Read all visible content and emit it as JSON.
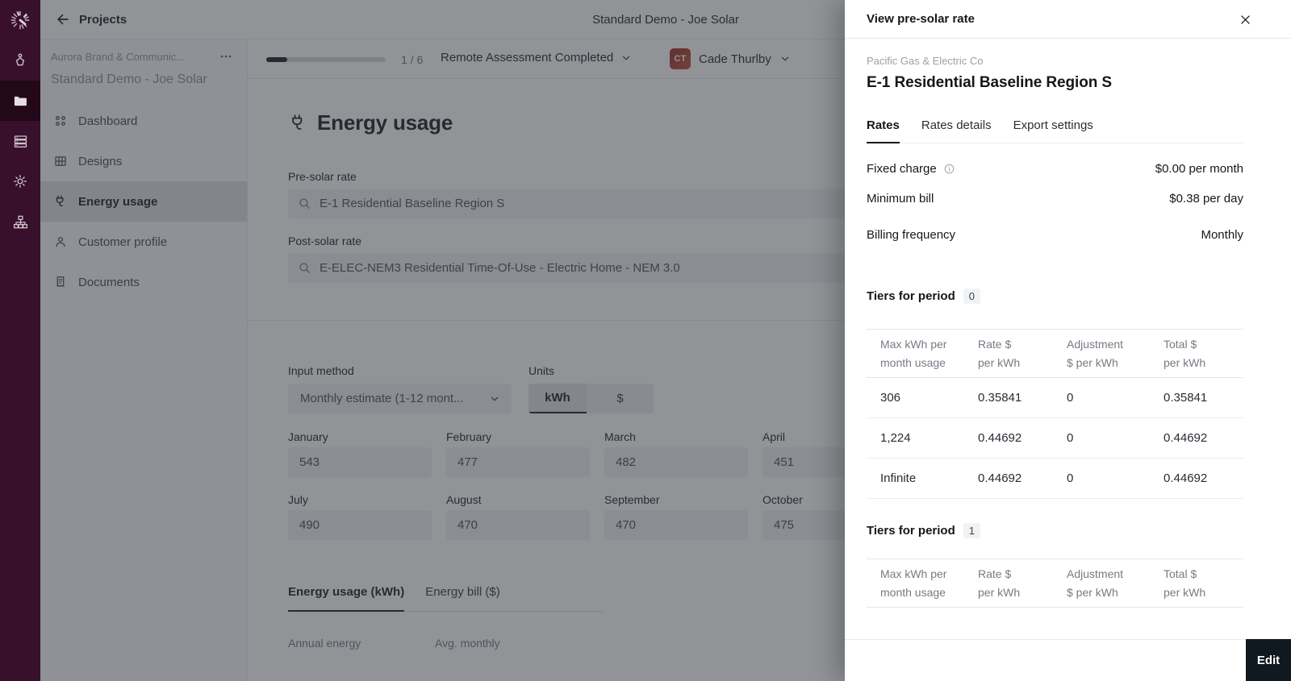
{
  "header": {
    "back_label": "Projects",
    "title": "Standard Demo - Joe Solar"
  },
  "rail": {
    "icons": [
      "aurora-logo",
      "sales-mode",
      "projects-folder",
      "proposals-list",
      "settings-gear",
      "org-chart"
    ]
  },
  "sidebar": {
    "org_name": "Aurora Brand & Communic...",
    "org_menu": "...",
    "project_name": "Standard Demo - Joe Solar",
    "items": [
      {
        "label": "Dashboard",
        "icon": "dashboard-icon",
        "active": false
      },
      {
        "label": "Designs",
        "icon": "designs-icon",
        "active": false
      },
      {
        "label": "Energy usage",
        "icon": "plug-icon",
        "active": true
      },
      {
        "label": "Customer profile",
        "icon": "person-icon",
        "active": false
      },
      {
        "label": "Documents",
        "icon": "document-icon",
        "active": false
      }
    ]
  },
  "toolbar": {
    "progress_label": "1 / 6",
    "status_dropdown": "Remote Assessment Completed",
    "user": {
      "initials": "CT",
      "name": "Cade Thurlby"
    },
    "avatar_color": "#9c2c26"
  },
  "main": {
    "title": "Energy usage",
    "pre_solar": {
      "label": "Pre-solar rate",
      "value": "E-1 Residential Baseline Region S"
    },
    "post_solar": {
      "label": "Post-solar rate",
      "value": "E-ELEC-NEM3 Residential Time-Of-Use - Electric Home - NEM 3.0"
    },
    "input_method": {
      "label": "Input method",
      "value": "Monthly estimate (1-12 mont..."
    },
    "units": {
      "label": "Units",
      "options": [
        "kWh",
        "$"
      ],
      "active": "kWh"
    },
    "months_row1": [
      {
        "label": "January",
        "value": "543"
      },
      {
        "label": "February",
        "value": "477"
      },
      {
        "label": "March",
        "value": "482"
      },
      {
        "label": "April",
        "value": "451"
      }
    ],
    "months_row2": [
      {
        "label": "July",
        "value": "490"
      },
      {
        "label": "August",
        "value": "470"
      },
      {
        "label": "September",
        "value": "470"
      },
      {
        "label": "October",
        "value": "475"
      }
    ],
    "chart_tabs": [
      {
        "label": "Energy usage (kWh)",
        "active": true
      },
      {
        "label": "Energy bill ($)",
        "active": false
      }
    ],
    "stats": [
      {
        "label": "Annual energy"
      },
      {
        "label": "Avg. monthly"
      }
    ]
  },
  "modal": {
    "title": "View pre-solar rate",
    "utility": "Pacific Gas & Electric Co",
    "rate_name": "E-1 Residential Baseline Region S",
    "tabs": [
      {
        "label": "Rates",
        "active": true
      },
      {
        "label": "Rates details",
        "active": false
      },
      {
        "label": "Export settings",
        "active": false
      }
    ],
    "summary": [
      {
        "label": "Fixed charge",
        "value": "$0.00 per month"
      },
      {
        "label": "Minimum bill",
        "value": "$0.38 per day"
      },
      {
        "label": "Billing frequency",
        "value": "Monthly"
      }
    ],
    "columns": [
      "Max kWh per\nmonth usage",
      "Rate $\nper kWh",
      "Adjustment\n$ per kWh",
      "Total $\nper kWh"
    ],
    "tier_sections": [
      {
        "heading": "Tiers for period",
        "badge": "0",
        "rows": [
          [
            "306",
            "0.35841",
            "0",
            "0.35841"
          ],
          [
            "1,224",
            "0.44692",
            "0",
            "0.44692"
          ],
          [
            "Infinite",
            "0.44692",
            "0",
            "0.44692"
          ]
        ]
      },
      {
        "heading": "Tiers for period",
        "badge": "1",
        "rows": []
      }
    ],
    "edit_label": "Edit"
  }
}
